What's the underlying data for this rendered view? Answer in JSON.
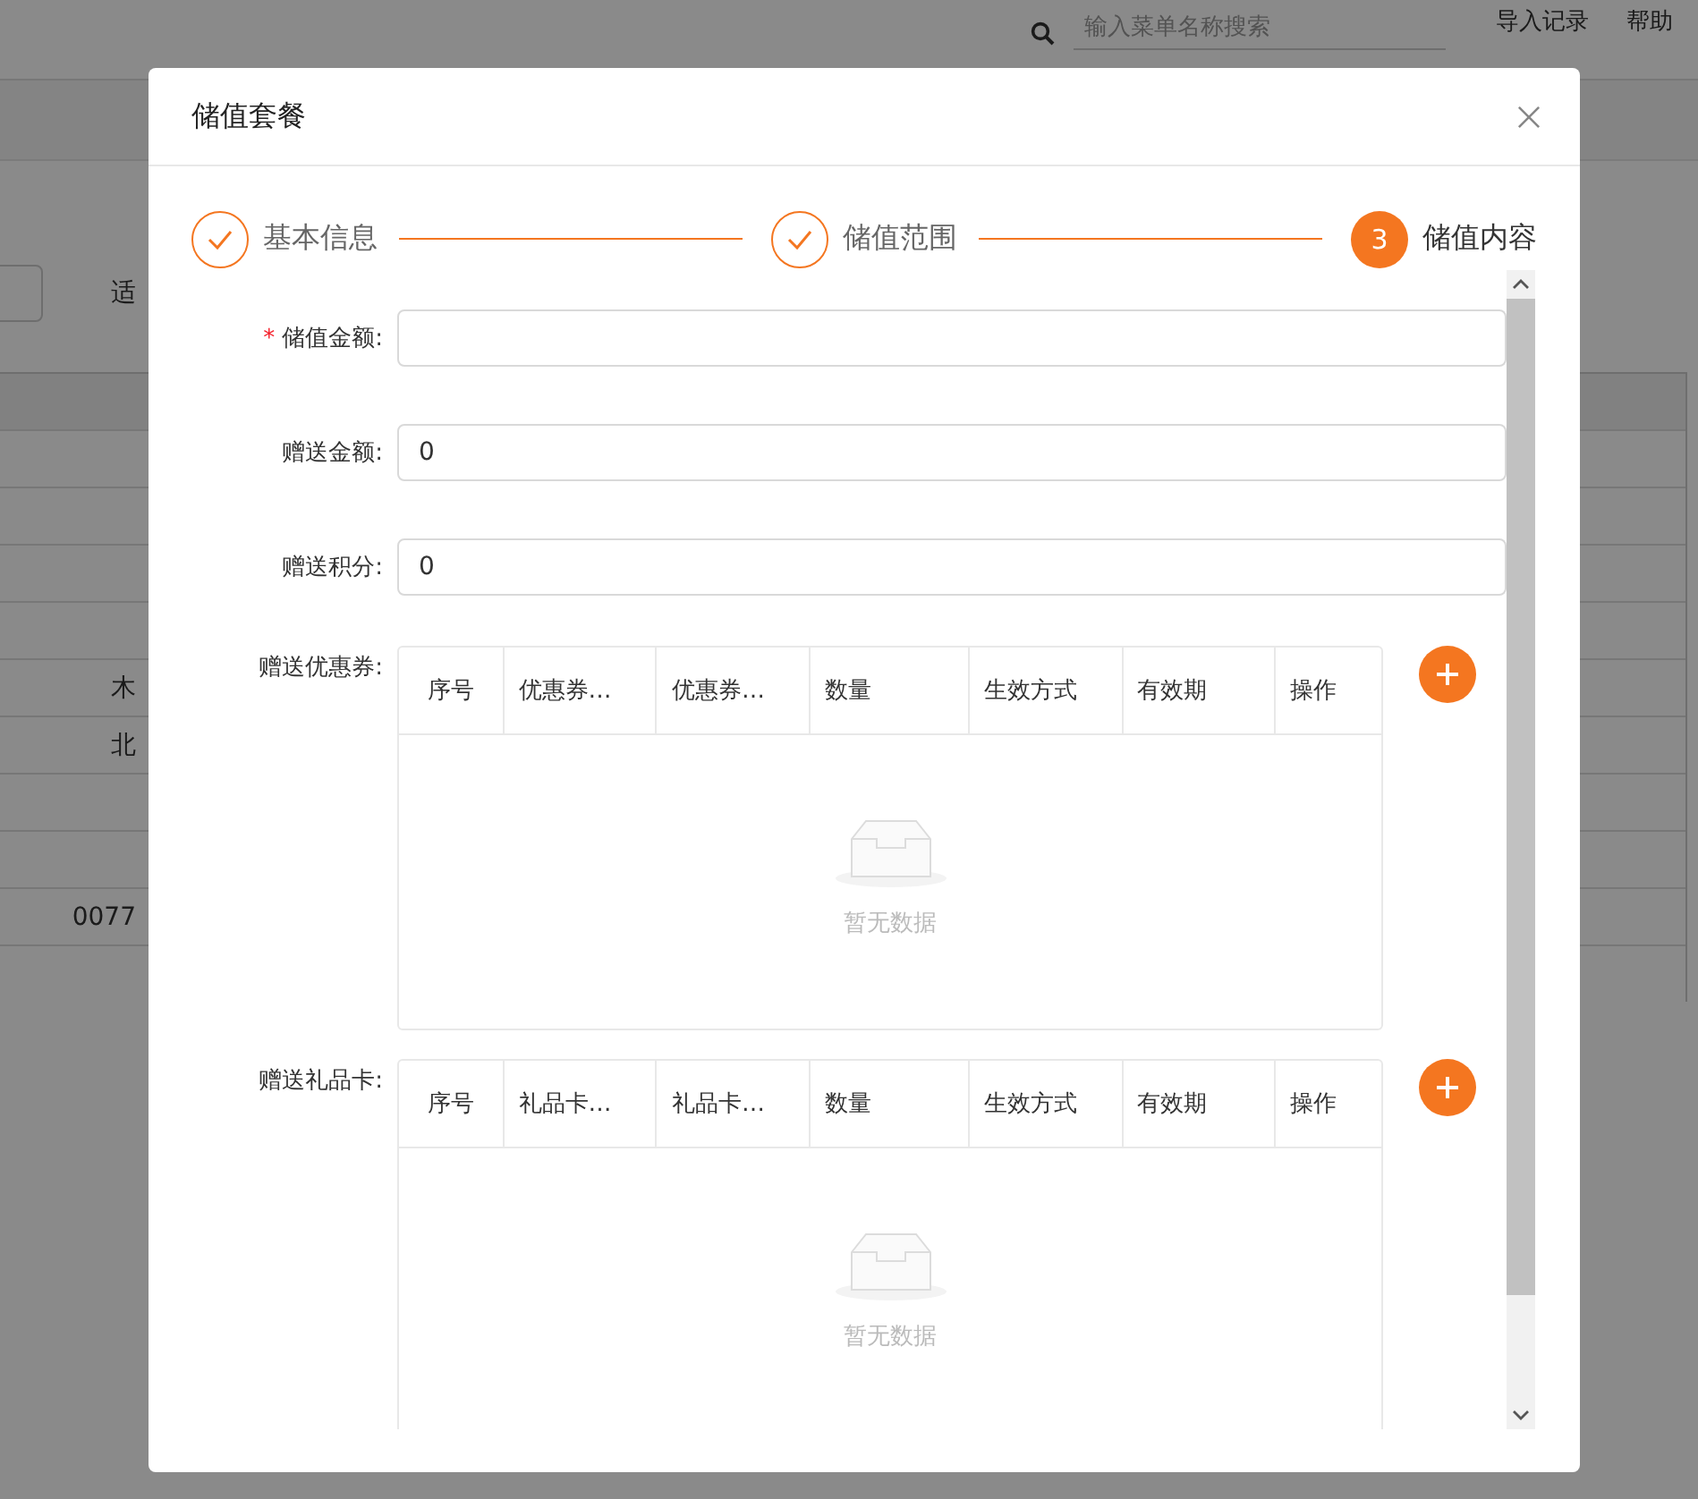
{
  "page": {
    "search": {
      "placeholder": "输入菜单名称搜索"
    },
    "links": [
      "导入记录",
      "帮助"
    ],
    "filter_label": "适",
    "table_cells": [
      "木",
      "北",
      "0077"
    ]
  },
  "dialog": {
    "title": "储值套餐",
    "steps": [
      {
        "label": "基本信息",
        "done": true
      },
      {
        "label": "储值范围",
        "done": true
      },
      {
        "label": "储值内容",
        "done": false,
        "number": "3"
      }
    ],
    "fields": [
      {
        "label": "储值金额:",
        "required_mark": "*"
      },
      {
        "label": "赠送金额:",
        "value": "0"
      },
      {
        "label": "赠送积分:",
        "value": "0"
      }
    ],
    "tables": [
      {
        "label": "赠送优惠券:",
        "columns": [
          "序号",
          "优惠券…",
          "优惠券…",
          "数量",
          "生效方式",
          "有效期",
          "操作"
        ],
        "empty_text": "暂无数据"
      },
      {
        "label": "赠送礼品卡:",
        "columns": [
          "序号",
          "礼品卡…",
          "礼品卡…",
          "数量",
          "生效方式",
          "有效期",
          "操作"
        ],
        "empty_text": "暂无数据"
      }
    ]
  }
}
